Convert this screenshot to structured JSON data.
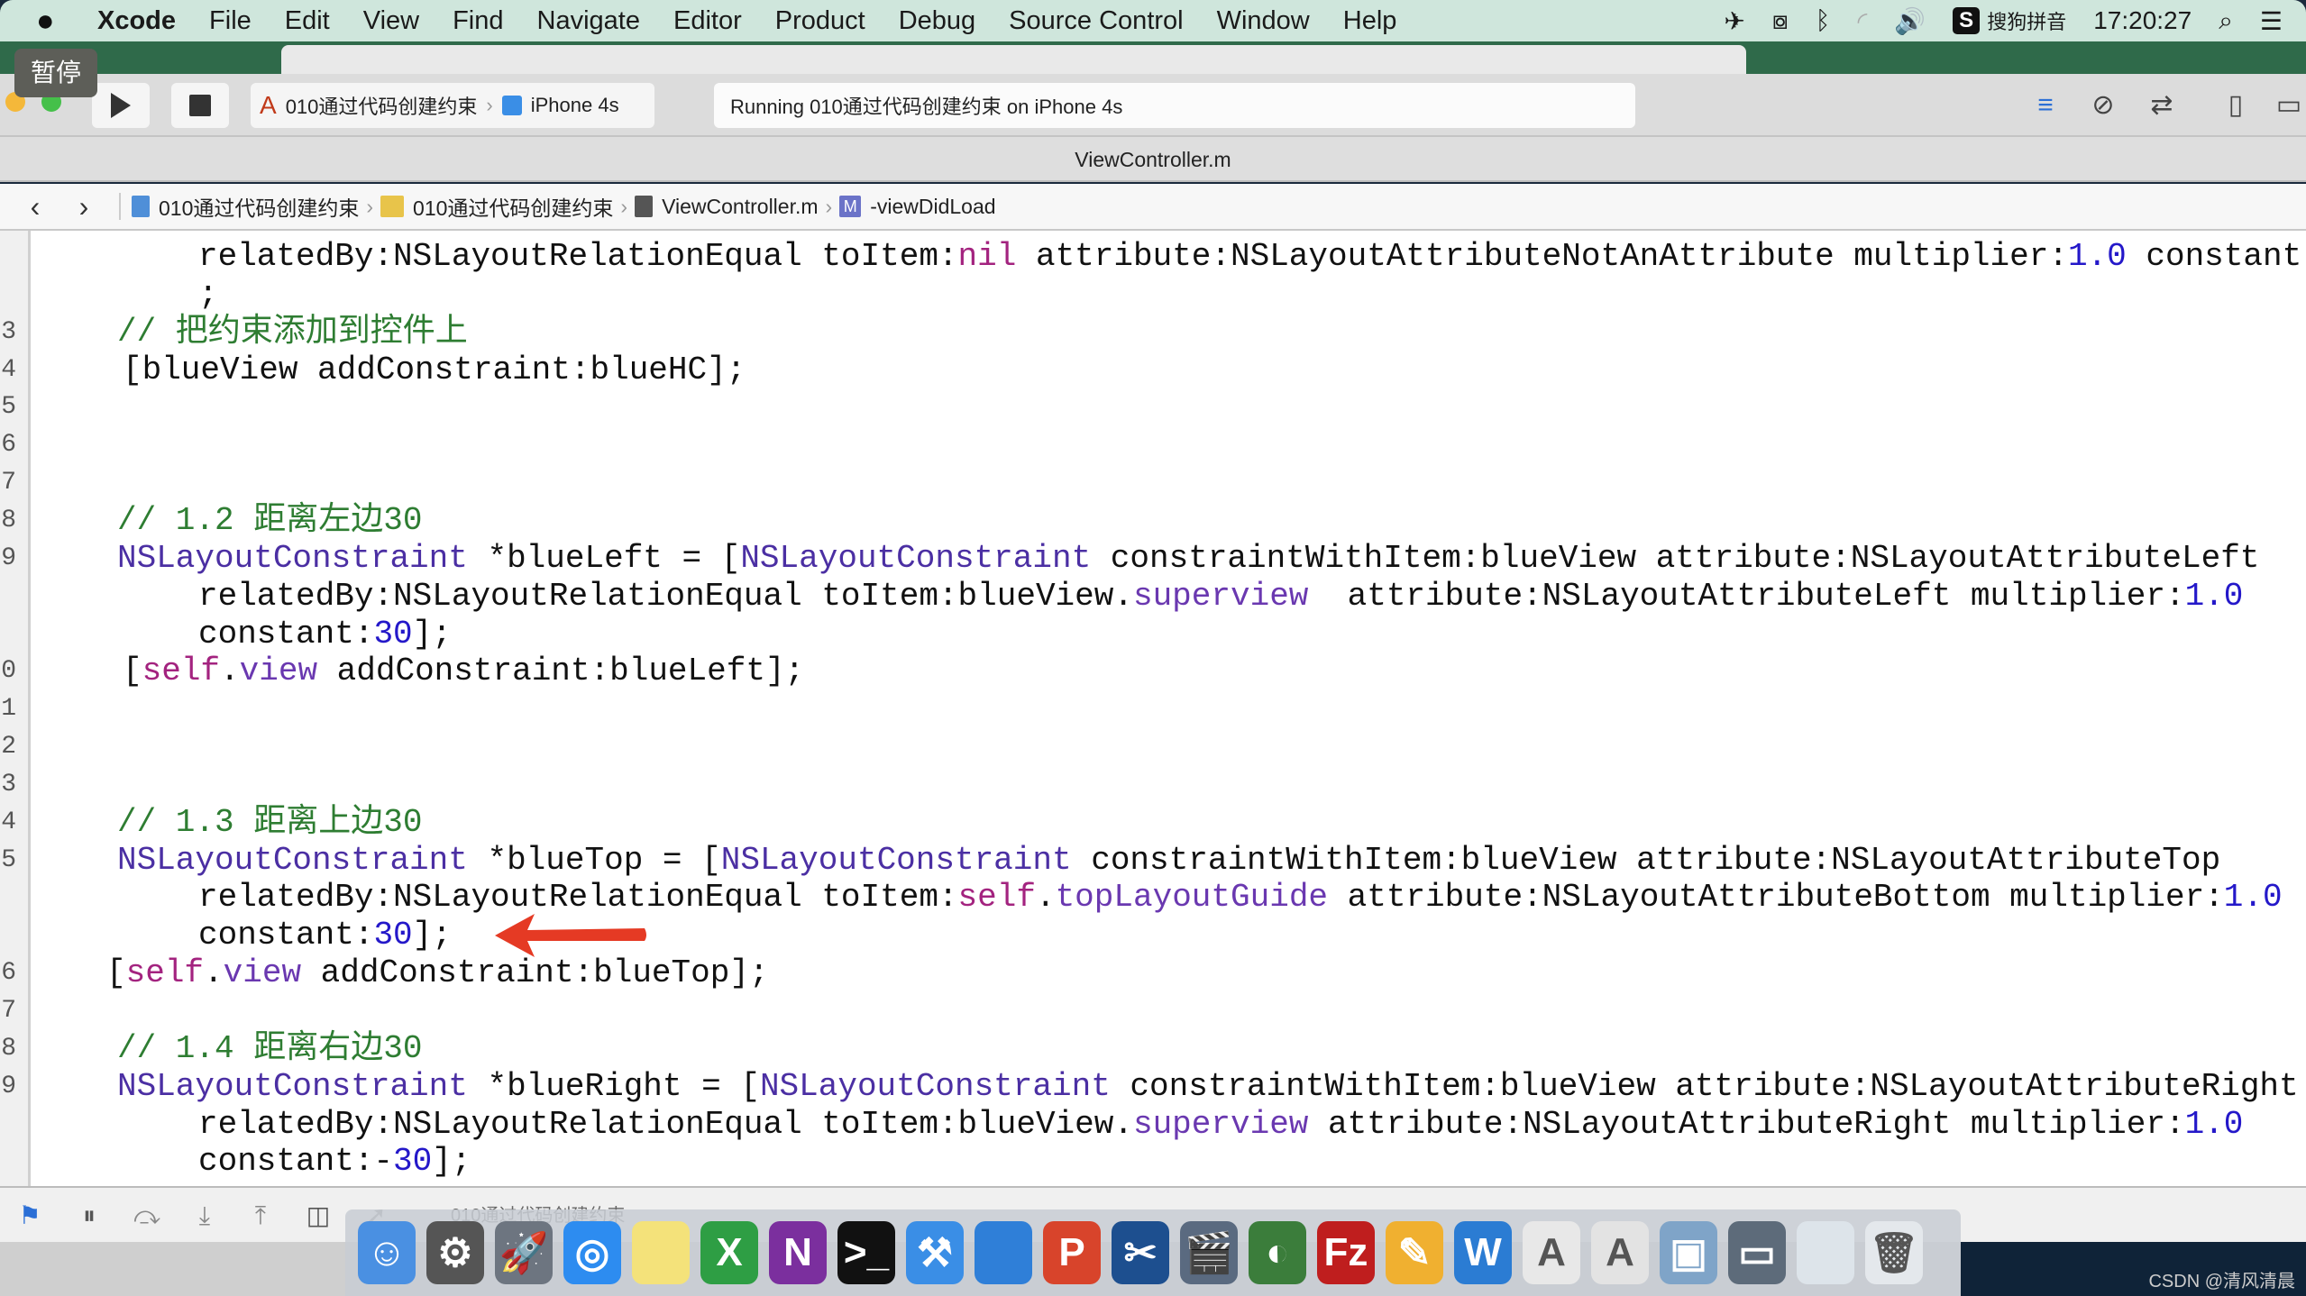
{
  "menubar": {
    "app": "Xcode",
    "items": [
      "File",
      "Edit",
      "View",
      "Find",
      "Navigate",
      "Editor",
      "Product",
      "Debug",
      "Source Control",
      "Window",
      "Help"
    ],
    "input_method_badge": "S",
    "input_method": "搜狗拼音",
    "clock": "17:20:27"
  },
  "tooltip": "暂停",
  "toolbar": {
    "scheme": "010通过代码创建约束",
    "device": "iPhone 4s",
    "activity": "Running 010通过代码创建约束 on iPhone 4s"
  },
  "tab_title": "ViewController.m",
  "jumpbar": {
    "back": "‹",
    "forward": "›",
    "crumbs": [
      "010通过代码创建约束",
      "010通过代码创建约束",
      "ViewController.m",
      "-viewDidLoad"
    ],
    "method_badge": "M"
  },
  "code": [
    {
      "ln": "",
      "indent": 220,
      "tokens": [
        [
          "p",
          "relatedBy:NSLayoutRelationEqual toItem:"
        ],
        [
          "k",
          "nil"
        ],
        [
          "p",
          " attribute:NSLayoutAttributeNotAnAttribute multiplier:"
        ],
        [
          "n",
          "1.0"
        ],
        [
          "p",
          " constant"
        ]
      ]
    },
    {
      "ln": "",
      "indent": 220,
      "tokens": [
        [
          "p",
          ";"
        ]
      ]
    },
    {
      "ln": "3",
      "indent": 130,
      "tokens": [
        [
          "m",
          "// 把约束添加到控件上"
        ]
      ]
    },
    {
      "ln": "4",
      "indent": 136,
      "tokens": [
        [
          "p",
          "[blueView addConstraint:blueHC];"
        ]
      ]
    },
    {
      "ln": "5",
      "indent": 130,
      "tokens": []
    },
    {
      "ln": "6",
      "indent": 130,
      "tokens": []
    },
    {
      "ln": "7",
      "indent": 130,
      "tokens": []
    },
    {
      "ln": "8",
      "indent": 130,
      "tokens": [
        [
          "m",
          "// 1.2 距离左边30"
        ]
      ]
    },
    {
      "ln": "9",
      "indent": 130,
      "tokens": [
        [
          "c",
          "NSLayoutConstraint"
        ],
        [
          "p",
          " *blueLeft = ["
        ],
        [
          "c",
          "NSLayoutConstraint"
        ],
        [
          "p",
          " constraintWithItem:blueView attribute:NSLayoutAttributeLeft"
        ]
      ]
    },
    {
      "ln": "",
      "indent": 220,
      "tokens": [
        [
          "p",
          "relatedBy:NSLayoutRelationEqual toItem:blueView."
        ],
        [
          "v",
          "superview"
        ],
        [
          "p",
          "  attribute:NSLayoutAttributeLeft multiplier:"
        ],
        [
          "n",
          "1.0"
        ]
      ]
    },
    {
      "ln": "",
      "indent": 220,
      "tokens": [
        [
          "p",
          "constant:"
        ],
        [
          "n",
          "30"
        ],
        [
          "p",
          "];"
        ]
      ]
    },
    {
      "ln": "0",
      "indent": 136,
      "tokens": [
        [
          "p",
          "["
        ],
        [
          "k",
          "self"
        ],
        [
          "p",
          "."
        ],
        [
          "v",
          "view"
        ],
        [
          "p",
          " addConstraint:blueLeft];"
        ]
      ]
    },
    {
      "ln": "1",
      "indent": 130,
      "tokens": []
    },
    {
      "ln": "2",
      "indent": 130,
      "tokens": []
    },
    {
      "ln": "3",
      "indent": 130,
      "tokens": []
    },
    {
      "ln": "4",
      "indent": 130,
      "tokens": [
        [
          "m",
          "// 1.3 距离上边30"
        ]
      ]
    },
    {
      "ln": "5",
      "indent": 130,
      "tokens": [
        [
          "c",
          "NSLayoutConstraint"
        ],
        [
          "p",
          " *blueTop = ["
        ],
        [
          "c",
          "NSLayoutConstraint"
        ],
        [
          "p",
          " constraintWithItem:blueView attribute:NSLayoutAttributeTop"
        ]
      ]
    },
    {
      "ln": "",
      "indent": 220,
      "tokens": [
        [
          "p",
          "relatedBy:NSLayoutRelationEqual toItem:"
        ],
        [
          "k",
          "self"
        ],
        [
          "p",
          "."
        ],
        [
          "v",
          "topLayoutGuide"
        ],
        [
          "p",
          " attribute:NSLayoutAttributeBottom multiplier:"
        ],
        [
          "n",
          "1.0"
        ]
      ]
    },
    {
      "ln": "",
      "indent": 220,
      "tokens": [
        [
          "p",
          "constant:"
        ],
        [
          "n",
          "30"
        ],
        [
          "p",
          "];"
        ]
      ]
    },
    {
      "ln": "6",
      "indent": 118,
      "tokens": [
        [
          "p",
          "["
        ],
        [
          "k",
          "self"
        ],
        [
          "p",
          "."
        ],
        [
          "v",
          "view"
        ],
        [
          "p",
          " addConstraint:blueTop];"
        ]
      ]
    },
    {
      "ln": "7",
      "indent": 130,
      "tokens": []
    },
    {
      "ln": "8",
      "indent": 130,
      "tokens": [
        [
          "m",
          "// 1.4 距离右边30"
        ]
      ]
    },
    {
      "ln": "9",
      "indent": 130,
      "tokens": [
        [
          "c",
          "NSLayoutConstraint"
        ],
        [
          "p",
          " *blueRight = ["
        ],
        [
          "c",
          "NSLayoutConstraint"
        ],
        [
          "p",
          " constraintWithItem:blueView attribute:NSLayoutAttributeRight"
        ]
      ]
    },
    {
      "ln": "",
      "indent": 220,
      "tokens": [
        [
          "p",
          "relatedBy:NSLayoutRelationEqual toItem:blueView."
        ],
        [
          "v",
          "superview"
        ],
        [
          "p",
          " attribute:NSLayoutAttributeRight multiplier:"
        ],
        [
          "n",
          "1.0"
        ]
      ]
    },
    {
      "ln": "",
      "indent": 220,
      "tokens": [
        [
          "p",
          "constant:-"
        ],
        [
          "n",
          "30"
        ],
        [
          "p",
          "];"
        ]
      ]
    }
  ],
  "debug_bar": {
    "target": "010通过代码创建约束"
  },
  "dock": [
    {
      "icon": "finder-icon",
      "color": "#4a90e2",
      "glyph": "☺"
    },
    {
      "icon": "system-preferences-icon",
      "color": "#555555",
      "glyph": "⚙"
    },
    {
      "icon": "launchpad-icon",
      "color": "#6d7580",
      "glyph": "🚀"
    },
    {
      "icon": "safari-icon",
      "color": "#2d8cf0",
      "glyph": "◎"
    },
    {
      "icon": "notes-icon",
      "color": "#f4e27a",
      "glyph": ""
    },
    {
      "icon": "excel-icon",
      "color": "#2e9e44",
      "glyph": "X"
    },
    {
      "icon": "onenote-icon",
      "color": "#7b2f9e",
      "glyph": "N"
    },
    {
      "icon": "terminal-icon",
      "color": "#111111",
      "glyph": ">_"
    },
    {
      "icon": "xcode-icon",
      "color": "#3a8ee6",
      "glyph": "⚒"
    },
    {
      "icon": "folder-icon",
      "color": "#2f7fd8",
      "glyph": ""
    },
    {
      "icon": "powerpoint-icon",
      "color": "#d8442b",
      "glyph": "P"
    },
    {
      "icon": "instruments-icon",
      "color": "#1d4f8f",
      "glyph": "✂"
    },
    {
      "icon": "screenflow-icon",
      "color": "#5a6a80",
      "glyph": "🎬"
    },
    {
      "icon": "network-icon",
      "color": "#3b7d3b",
      "glyph": "◐"
    },
    {
      "icon": "filezilla-icon",
      "color": "#bf1e1e",
      "glyph": "Fz"
    },
    {
      "icon": "sketch-icon",
      "color": "#f0b030",
      "glyph": "✎"
    },
    {
      "icon": "word-icon",
      "color": "#2b7cd3",
      "glyph": "W"
    },
    {
      "icon": "font-book-icon",
      "color": "#e8e8e8",
      "glyph": "A"
    },
    {
      "icon": "dictionary-icon",
      "color": "#e3e3e3",
      "glyph": "A"
    },
    {
      "icon": "preview-icon",
      "color": "#7fa4c8",
      "glyph": "▣"
    },
    {
      "icon": "screen-sharing-icon",
      "color": "#5d6b7a",
      "glyph": "▭"
    },
    {
      "icon": "window-icon",
      "color": "#dde4ea",
      "glyph": ""
    },
    {
      "icon": "trash-icon",
      "color": "#e4e8ec",
      "glyph": "🗑"
    }
  ],
  "watermark": "CSDN @清风清晨",
  "colors": {
    "menubar": "#cfe6dc",
    "arrow": "#e53a24",
    "comment": "#2e7d32",
    "number": "#2418c9",
    "keyword": "#a3237f"
  }
}
